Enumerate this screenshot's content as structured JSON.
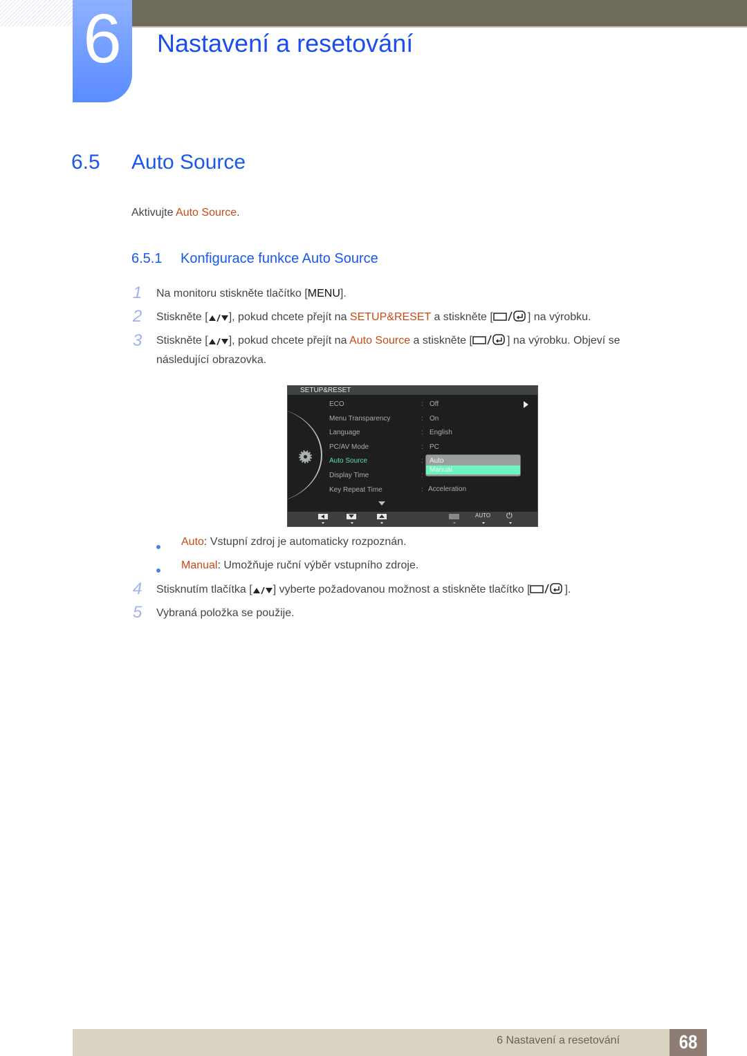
{
  "header": {
    "chapter_number": "6",
    "chapter_title": "Nastavení a resetování"
  },
  "section": {
    "number": "6.5",
    "title": "Auto Source",
    "intro_prefix": "Aktivujte ",
    "intro_highlight": "Auto Source",
    "intro_suffix": "."
  },
  "subsection": {
    "number": "6.5.1",
    "title": "Konfigurace funkce Auto Source"
  },
  "steps": [
    {
      "n": "1",
      "before": "Na monitoru stiskněte tlačítko [",
      "key": "MENU",
      "after": "]."
    },
    {
      "n": "2",
      "before": "Stiskněte [",
      "mid1": "], pokud chcete přejít na ",
      "highlight": "SETUP&RESET",
      "mid2": " a stiskněte [",
      "after": "] na výrobku."
    },
    {
      "n": "3",
      "before": "Stiskněte [",
      "mid1": "], pokud chcete přejít na ",
      "highlight": "Auto Source",
      "mid2": " a stiskněte [",
      "after": "] na výrobku. Objeví se",
      "line2": "následující obrazovka."
    },
    {
      "n": "4",
      "before": "Stisknutím tlačítka [",
      "mid1": "] vyberte požadovanou možnost a stiskněte tlačítko [",
      "after": "]."
    },
    {
      "n": "5",
      "text": "Vybraná položka se použije."
    }
  ],
  "osd": {
    "header": "SETUP&RESET",
    "items": [
      {
        "label": "ECO",
        "value": "Off"
      },
      {
        "label": "Menu Transparency",
        "value": "On"
      },
      {
        "label": "Language",
        "value": "English"
      },
      {
        "label": "PC/AV Mode",
        "value": "PC"
      },
      {
        "label": "Auto Source",
        "value": ""
      },
      {
        "label": "Display Time",
        "value": ""
      },
      {
        "label": "Key Repeat Time",
        "value": "Acceleration"
      }
    ],
    "active_item": "Auto Source",
    "dropdown_options": [
      "Auto",
      "Manual"
    ],
    "dropdown_selected": "Manual",
    "footer_auto": "AUTO",
    "colors": {
      "active": "#5ee0a8",
      "selected_bg": "#6cf5be"
    }
  },
  "bullets": [
    {
      "term": "Auto",
      "text": ": Vstupní zdroj je automaticky rozpoznán."
    },
    {
      "term": "Manual",
      "text": ": Umožňuje ruční výběr vstupního zdroje."
    }
  ],
  "footer": {
    "chapter_label": "6 Nastavení a resetování",
    "page_number": "68"
  },
  "colors": {
    "heading_blue": "#1a57f0",
    "highlight_orange": "#c64a14",
    "step_number": "#9fb4ea",
    "footer_bg": "#d9d3c1",
    "page_box": "#8e7d74"
  }
}
